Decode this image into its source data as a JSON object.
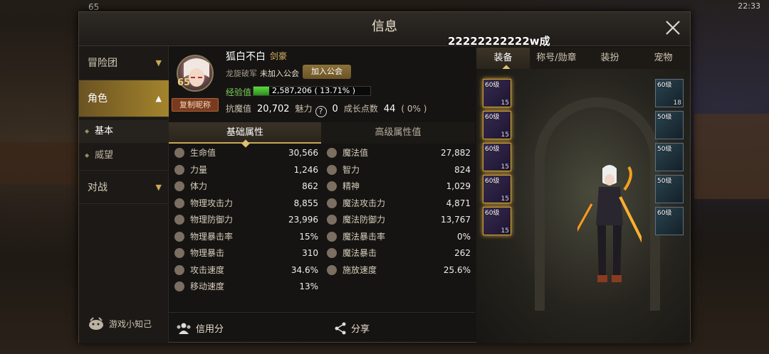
{
  "window": {
    "title": "信息",
    "overlay_text": "22222222222w成",
    "top_left_level": "65",
    "top_right_status": "22:33"
  },
  "sidebar": {
    "items": [
      {
        "label": "冒险团"
      },
      {
        "label": "角色"
      },
      {
        "label": "对战"
      }
    ],
    "sub_items": [
      {
        "label": "基本"
      },
      {
        "label": "威望"
      }
    ],
    "tips_label": "游戏小知己"
  },
  "profile": {
    "level": "65",
    "copy_nickname_label": "复制昵称",
    "name": "狐白不白",
    "class": "剑豪",
    "server": "龙旋破军",
    "guild_status": "未加入公会",
    "join_guild_label": "加入公会",
    "exp_label": "经验值",
    "exp_text": "2,587,206 ( 13.71% )",
    "exp_fraction": 0.1371,
    "anti_magic_label": "抗魔值",
    "anti_magic_value": "20,702",
    "charm_label": "魅力",
    "charm_value": "0",
    "growth_label": "成长点数",
    "growth_value": "44",
    "growth_pct": "( 0% )"
  },
  "attr_tabs": [
    {
      "label": "基础属性"
    },
    {
      "label": "高级属性值"
    }
  ],
  "attrs_left": [
    {
      "label": "生命值",
      "value": "30,566"
    },
    {
      "label": "力量",
      "value": "1,246"
    },
    {
      "label": "体力",
      "value": "862"
    },
    {
      "label": "物理攻击力",
      "value": "8,855"
    },
    {
      "label": "物理防御力",
      "value": "23,996"
    },
    {
      "label": "物理暴击率",
      "value": "15%"
    },
    {
      "label": "物理暴击",
      "value": "310"
    },
    {
      "label": "攻击速度",
      "value": "34.6%"
    },
    {
      "label": "移动速度",
      "value": "13%"
    }
  ],
  "attrs_right": [
    {
      "label": "魔法值",
      "value": "27,882"
    },
    {
      "label": "智力",
      "value": "824"
    },
    {
      "label": "精神",
      "value": "1,029"
    },
    {
      "label": "魔法攻击力",
      "value": "4,871"
    },
    {
      "label": "魔法防御力",
      "value": "13,767"
    },
    {
      "label": "魔法暴击率",
      "value": "0%"
    },
    {
      "label": "魔法暴击",
      "value": "262"
    },
    {
      "label": "施放速度",
      "value": "25.6%"
    }
  ],
  "bottom": {
    "credit_label": "信用分",
    "share_label": "分享"
  },
  "right_tabs": [
    {
      "label": "装备"
    },
    {
      "label": "称号/勋章"
    },
    {
      "label": "装扮"
    },
    {
      "label": "宠物"
    }
  ],
  "left_slots": [
    {
      "level": "60级",
      "count": "15"
    },
    {
      "level": "60级",
      "count": "15"
    },
    {
      "level": "60级",
      "count": "15"
    },
    {
      "level": "60级",
      "count": "15"
    },
    {
      "level": "60级",
      "count": "15"
    }
  ],
  "right_slots": [
    {
      "level": "60级",
      "count": "18"
    },
    {
      "level": "50级",
      "count": ""
    },
    {
      "level": "50级",
      "count": ""
    },
    {
      "level": "50级",
      "count": ""
    },
    {
      "level": "60级",
      "count": ""
    }
  ]
}
